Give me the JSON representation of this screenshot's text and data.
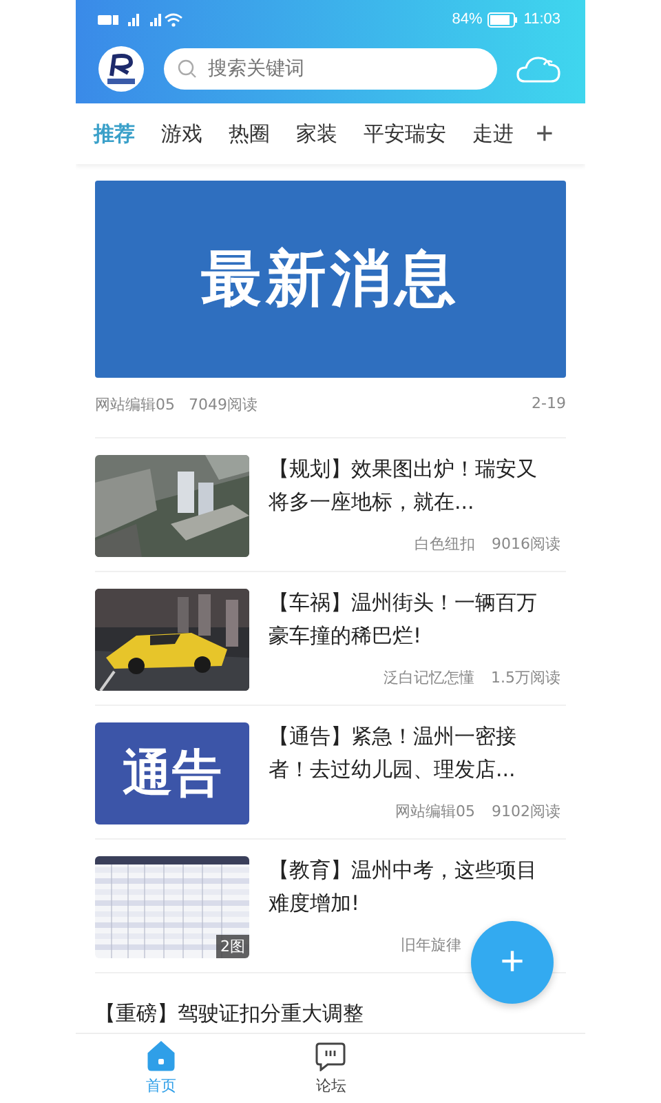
{
  "status_bar": {
    "battery": "84%",
    "time": "11:03"
  },
  "search": {
    "placeholder": "搜索关键词"
  },
  "tabs": [
    {
      "label": "推荐",
      "selected": true
    },
    {
      "label": "游戏",
      "selected": false
    },
    {
      "label": "热圈",
      "selected": false
    },
    {
      "label": "家装",
      "selected": false
    },
    {
      "label": "平安瑞安",
      "selected": false
    },
    {
      "label": "走进",
      "selected": false
    }
  ],
  "add_tab": "+",
  "featured": {
    "banner_text": "最新消息",
    "author": "网站编辑05",
    "reads": "7049阅读",
    "date": "2-19"
  },
  "articles": [
    {
      "kind": "buildings",
      "title": "【规划】效果图出炉！瑞安又将多一座地标，就在...",
      "author": "白色纽扣",
      "reads": "9016阅读"
    },
    {
      "kind": "car",
      "title": "【车祸】温州街头！一辆百万豪车撞的稀巴烂!",
      "author": "泛白记忆怎懂",
      "reads": "1.5万阅读"
    },
    {
      "kind": "notice",
      "thumb_text": "通告",
      "title": "【通告】紧急！温州一密接者！去过幼儿园、理发店...",
      "author": "网站编辑05",
      "reads": "9102阅读"
    },
    {
      "kind": "table",
      "image_count": "2图",
      "title": "【教育】温州中考，这些项目难度增加!",
      "author": "旧年旋律"
    }
  ],
  "partial_article": {
    "title": "【重磅】驾驶证扣分重大调整"
  },
  "fab": "+",
  "bottom_nav": [
    {
      "label": "首页",
      "kind": "home",
      "selected": true
    },
    {
      "label": "论坛",
      "kind": "chat",
      "selected": false
    }
  ]
}
